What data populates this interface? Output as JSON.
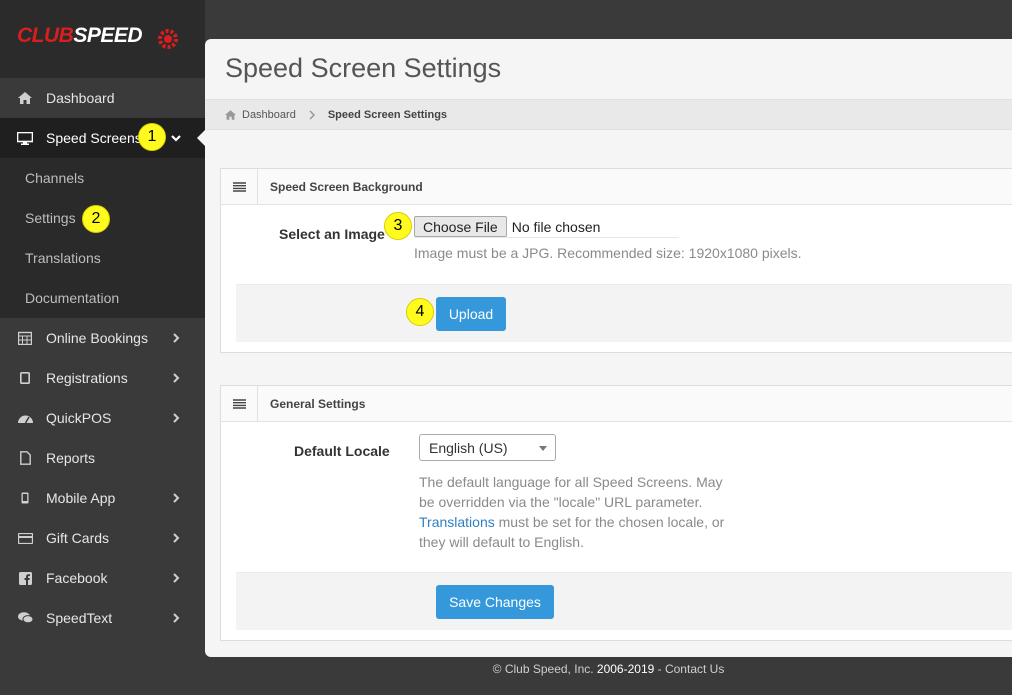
{
  "brand": {
    "logo_part1": "CLUB",
    "logo_part2": "SPEED",
    "accent": "#d81e1e"
  },
  "sidebar": {
    "items": [
      {
        "label": "Dashboard",
        "icon": "home-icon"
      },
      {
        "label": "Speed Screens",
        "icon": "monitor-icon"
      },
      {
        "label": "Online Bookings",
        "icon": "calendar-icon"
      },
      {
        "label": "Registrations",
        "icon": "tablet-icon"
      },
      {
        "label": "QuickPOS",
        "icon": "dashboard-icon"
      },
      {
        "label": "Reports",
        "icon": "file-icon"
      },
      {
        "label": "Mobile App",
        "icon": "mobile-icon"
      },
      {
        "label": "Gift Cards",
        "icon": "credit-card-icon"
      },
      {
        "label": "Facebook",
        "icon": "facebook-icon"
      },
      {
        "label": "SpeedText",
        "icon": "chat-icon"
      }
    ],
    "submenu": [
      "Channels",
      "Settings",
      "Translations",
      "Documentation"
    ]
  },
  "badges": [
    "1",
    "2",
    "3",
    "4"
  ],
  "page": {
    "title": "Speed Screen Settings"
  },
  "breadcrumb": {
    "home": "Dashboard",
    "current": "Speed Screen Settings"
  },
  "background_panel": {
    "title": "Speed Screen Background",
    "image_label": "Select an Image",
    "file_button": "Choose File",
    "file_status": "No file chosen",
    "help": "Image must be a JPG. Recommended size: 1920x1080 pixels.",
    "upload_label": "Upload"
  },
  "general_panel": {
    "title": "General Settings",
    "locale_label": "Default Locale",
    "locale_value": "English (US)",
    "help_line1": "The default language for all Speed Screens. May",
    "help_line2": "be overridden via the \"locale\" URL parameter.",
    "help_link": "Translations",
    "help_line3": " must be set for the chosen locale, or",
    "help_line4": "they will default to English.",
    "save_label": "Save Changes"
  },
  "footer": {
    "copy": "© Club Speed, Inc. ",
    "years": "2006-2019",
    "dash": " - ",
    "contact": "Contact Us"
  },
  "colors": {
    "primary_button": "#3498db",
    "sidebar_bg": "#3a3a3a",
    "badge": "#fffb1e"
  }
}
